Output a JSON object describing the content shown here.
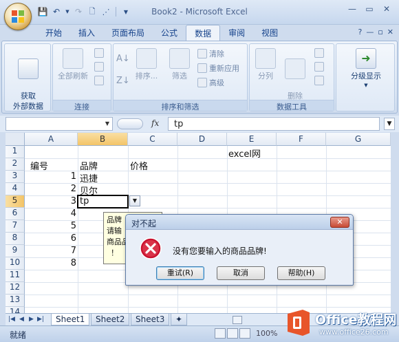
{
  "window": {
    "title": "Book2 - Microsoft Excel"
  },
  "tabs": [
    "开始",
    "插入",
    "页面布局",
    "公式",
    "数据",
    "审阅",
    "视图"
  ],
  "active_tab": "数据",
  "ribbon": {
    "groups": {
      "get_external": {
        "label": "获取\n外部数据"
      },
      "connections": {
        "label": "连接",
        "refresh_all": "全部刷新"
      },
      "sort_filter": {
        "label": "排序和筛选",
        "sort": "排序...",
        "filter": "筛选",
        "clear": "清除",
        "reapply": "重新应用",
        "advanced": "高级"
      },
      "data_tools": {
        "label": "数据工具",
        "split": "分列",
        "remove_dup": "删除\n重复项"
      },
      "outline": {
        "label": "分级显示"
      }
    }
  },
  "formula_bar": {
    "fx": "fx",
    "value": "tp"
  },
  "columns": [
    "A",
    "B",
    "C",
    "D",
    "E",
    "F",
    "G"
  ],
  "rows": [
    "1",
    "2",
    "3",
    "4",
    "5",
    "6",
    "7",
    "8",
    "9",
    "10",
    "11",
    "12",
    "13",
    "14"
  ],
  "cells": {
    "E1": "excel网",
    "A2": "编号",
    "B2": "品牌",
    "C2": "价格",
    "A3": "1",
    "B3": "迅捷",
    "A4": "2",
    "B4": "贝尔",
    "A5": "3",
    "B5": "tp",
    "A6": "4",
    "A7": "5",
    "A8": "6",
    "A9": "7",
    "A10": "8"
  },
  "tooltip": {
    "line1": "品牌",
    "line2": "请输",
    "line3": "商品品",
    "line4": "！"
  },
  "dialog": {
    "title": "对不起",
    "message": "没有您要输入的商品品牌!",
    "retry": "重试(R)",
    "cancel": "取消",
    "help": "帮助(H)"
  },
  "sheet_tabs": [
    "Sheet1",
    "Sheet2",
    "Sheet3"
  ],
  "status": {
    "text": "就绪",
    "zoom": "100%"
  },
  "watermark": {
    "brand": "Office教程网",
    "url": "www.office26.com"
  },
  "colors": {
    "accent": "#15428b",
    "error": "#c8102e",
    "selected_header": "#f3c467"
  }
}
